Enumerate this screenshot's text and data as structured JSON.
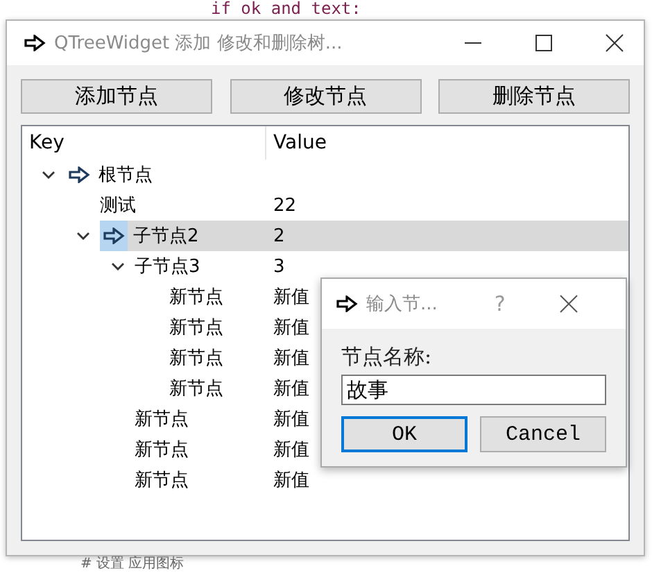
{
  "background_code": {
    "top_line": "if ok and text:",
    "bottom_line": "# 设置 应用图标"
  },
  "window": {
    "title": "QTreeWidget 添加 修改和删除树...",
    "buttons": [
      "添加节点",
      "修改节点",
      "删除节点"
    ]
  },
  "tree": {
    "columns": [
      "Key",
      "Value"
    ],
    "rows": [
      {
        "key": "根节点",
        "value": "",
        "has_icon": true,
        "expanded": true,
        "selected": false,
        "children": [
          {
            "key": "测试",
            "value": "22",
            "has_icon": false,
            "selected": false
          },
          {
            "key": "子节点2",
            "value": "2",
            "has_icon": true,
            "expanded": true,
            "selected": true,
            "children": [
              {
                "key": "子节点3",
                "value": "3",
                "has_icon": false,
                "expanded": true,
                "selected": false,
                "children": [
                  {
                    "key": "新节点",
                    "value": "新值",
                    "has_icon": false,
                    "selected": false
                  },
                  {
                    "key": "新节点",
                    "value": "新值",
                    "has_icon": false,
                    "selected": false
                  },
                  {
                    "key": "新节点",
                    "value": "新值",
                    "has_icon": false,
                    "selected": false
                  },
                  {
                    "key": "新节点",
                    "value": "新值",
                    "has_icon": false,
                    "selected": false
                  }
                ]
              },
              {
                "key": "新节点",
                "value": "新值",
                "has_icon": false,
                "selected": false
              },
              {
                "key": "新节点",
                "value": "新值",
                "has_icon": false,
                "selected": false
              },
              {
                "key": "新节点",
                "value": "新值",
                "has_icon": false,
                "selected": false
              }
            ]
          }
        ]
      }
    ]
  },
  "dialog": {
    "title": "输入节...",
    "help": "?",
    "label": "节点名称:",
    "value": "故事",
    "buttons": [
      {
        "label": "OK",
        "focused": true
      },
      {
        "label": "Cancel",
        "focused": false
      }
    ]
  }
}
